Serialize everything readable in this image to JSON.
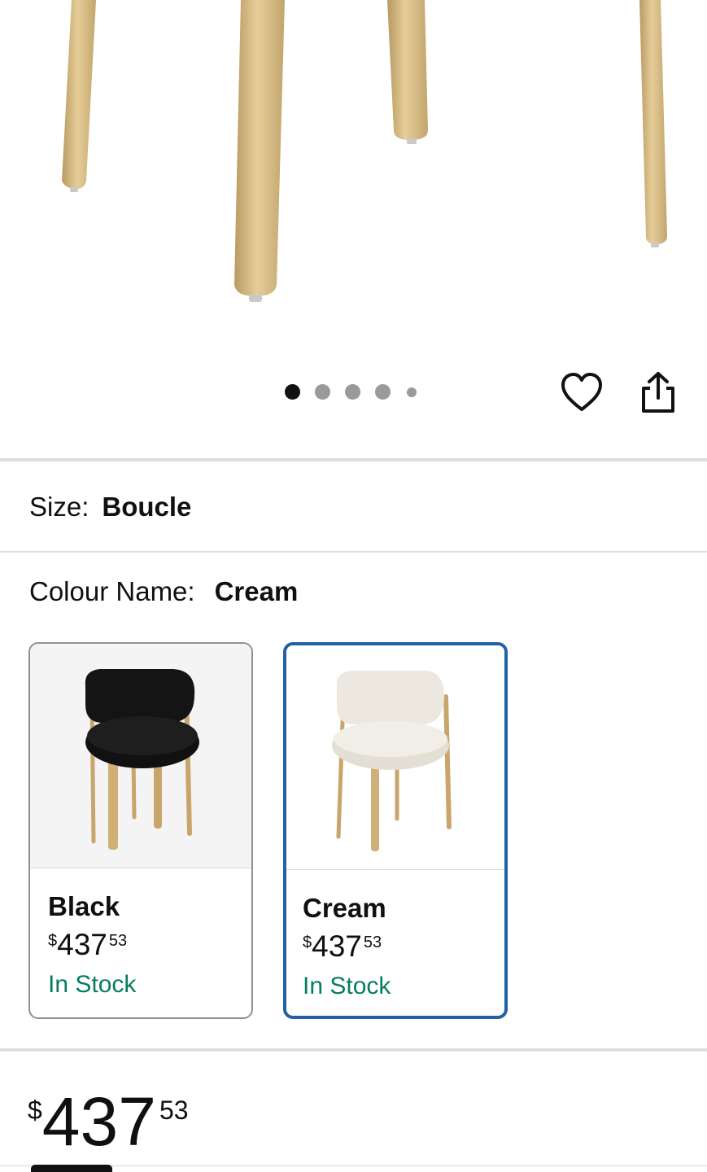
{
  "gallery": {
    "image_alt": "Chair legs close-up",
    "dot_count": 5,
    "active_dot": 0,
    "icons": {
      "favorite": "heart-icon",
      "share": "share-icon"
    }
  },
  "variations": {
    "size_label": "Size:",
    "size_value": "Boucle",
    "colour_label": "Colour Name:",
    "colour_value": "Cream",
    "swatches": [
      {
        "name": "Black",
        "currency": "$",
        "whole": "437",
        "fraction": "53",
        "stock": "In Stock",
        "selected": false
      },
      {
        "name": "Cream",
        "currency": "$",
        "whole": "437",
        "fraction": "53",
        "stock": "In Stock",
        "selected": true
      }
    ]
  },
  "price": {
    "currency": "$",
    "whole": "437",
    "fraction": "53"
  },
  "colors": {
    "selected_border": "#2162a1",
    "in_stock": "#067d62",
    "divider": "#dcdfe0",
    "chair_leg": "#d8bb85"
  }
}
